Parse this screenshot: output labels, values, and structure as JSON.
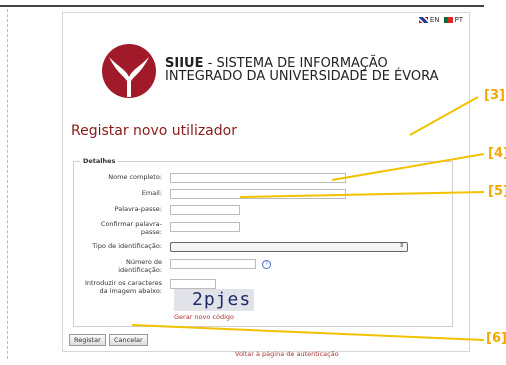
{
  "language": {
    "en_label": "EN",
    "pt_label": "PT"
  },
  "header": {
    "brand_short": "SIIUE",
    "brand_rest_line1": " - SISTEMA DE INFORMAÇÃO",
    "brand_line2": "INTEGRADO DA UNIVERSIDADE DE ÉVORA"
  },
  "page": {
    "title": "Registar novo utilizador"
  },
  "form": {
    "legend": "Detalhes",
    "fields": {
      "full_name": {
        "label": "Nome completo:",
        "value": ""
      },
      "email": {
        "label": "Email:",
        "value": ""
      },
      "password": {
        "label": "Palavra-passe:",
        "value": ""
      },
      "confirm_password": {
        "label_line1": "Confirmar palavra-",
        "label_line2": "passe:",
        "value": ""
      },
      "id_type": {
        "label": "Tipo de identificação:",
        "selected": ""
      },
      "id_number": {
        "label_line1": "Número de",
        "label_line2": "identificação:",
        "value": ""
      },
      "captcha_input": {
        "label_line1": "Introduzir os caracteres",
        "label_line2": "da imagem abaixo:",
        "value": ""
      }
    },
    "help_icon": "?",
    "captcha_text": "2pjes",
    "new_code_link": "Gerar novo código",
    "submit_label": "Registar",
    "cancel_label": "Cancelar"
  },
  "footer": {
    "back_link": "Voltar à página de autenticação"
  },
  "callouts": {
    "c3": "[3]",
    "c4": "[4]",
    "c5": "[5]",
    "c6": "[6]"
  },
  "colors": {
    "title_red": "#8b1a1a",
    "link_red": "#a33333",
    "callout": "#f2a700",
    "logo_red": "#a01a2a"
  },
  "icons": [
    "uk-flag-icon",
    "pt-flag-icon",
    "university-logo-icon",
    "help-icon",
    "select-arrow-icon"
  ]
}
